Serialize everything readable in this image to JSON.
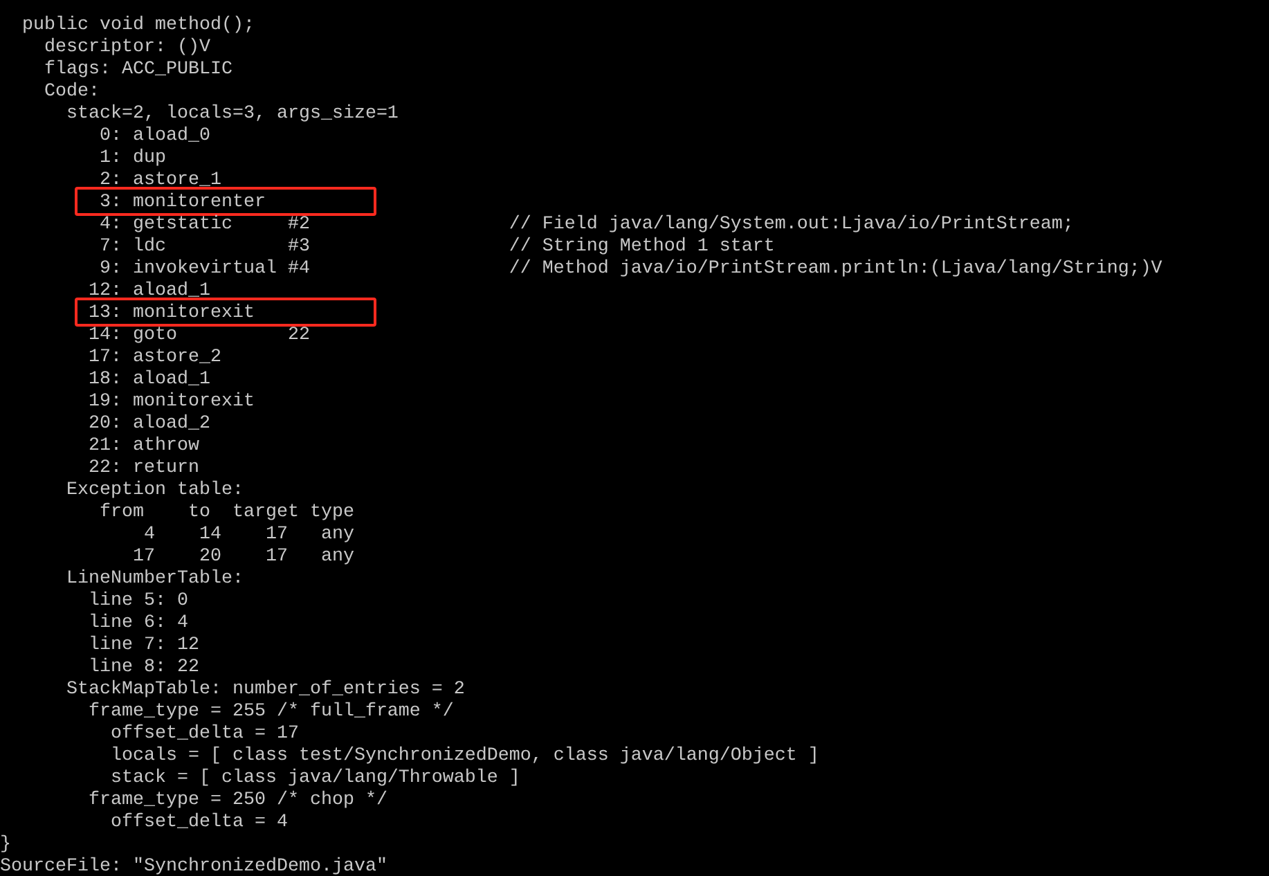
{
  "console": {
    "lines": [
      {
        "text": "  public void method();",
        "highlighted": false
      },
      {
        "text": "    descriptor: ()V",
        "highlighted": false
      },
      {
        "text": "    flags: ACC_PUBLIC",
        "highlighted": false
      },
      {
        "text": "    Code:",
        "highlighted": false
      },
      {
        "text": "      stack=2, locals=3, args_size=1",
        "highlighted": false
      },
      {
        "text": "         0: aload_0",
        "highlighted": false
      },
      {
        "text": "         1: dup",
        "highlighted": false
      },
      {
        "text": "         2: astore_1",
        "highlighted": false
      },
      {
        "text": "         3: monitorenter",
        "highlighted": true
      },
      {
        "text": "         4: getstatic     #2                  // Field java/lang/System.out:Ljava/io/PrintStream;",
        "highlighted": false
      },
      {
        "text": "         7: ldc           #3                  // String Method 1 start",
        "highlighted": false
      },
      {
        "text": "         9: invokevirtual #4                  // Method java/io/PrintStream.println:(Ljava/lang/String;)V",
        "highlighted": false
      },
      {
        "text": "        12: aload_1",
        "highlighted": false
      },
      {
        "text": "        13: monitorexit",
        "highlighted": true
      },
      {
        "text": "        14: goto          22",
        "highlighted": false
      },
      {
        "text": "        17: astore_2",
        "highlighted": false
      },
      {
        "text": "        18: aload_1",
        "highlighted": false
      },
      {
        "text": "        19: monitorexit",
        "highlighted": false
      },
      {
        "text": "        20: aload_2",
        "highlighted": false
      },
      {
        "text": "        21: athrow",
        "highlighted": false
      },
      {
        "text": "        22: return",
        "highlighted": false
      },
      {
        "text": "      Exception table:",
        "highlighted": false
      },
      {
        "text": "         from    to  target type",
        "highlighted": false
      },
      {
        "text": "             4    14    17   any",
        "highlighted": false
      },
      {
        "text": "            17    20    17   any",
        "highlighted": false
      },
      {
        "text": "      LineNumberTable:",
        "highlighted": false
      },
      {
        "text": "        line 5: 0",
        "highlighted": false
      },
      {
        "text": "        line 6: 4",
        "highlighted": false
      },
      {
        "text": "        line 7: 12",
        "highlighted": false
      },
      {
        "text": "        line 8: 22",
        "highlighted": false
      },
      {
        "text": "      StackMapTable: number_of_entries = 2",
        "highlighted": false
      },
      {
        "text": "        frame_type = 255 /* full_frame */",
        "highlighted": false
      },
      {
        "text": "          offset_delta = 17",
        "highlighted": false
      },
      {
        "text": "          locals = [ class test/SynchronizedDemo, class java/lang/Object ]",
        "highlighted": false
      },
      {
        "text": "          stack = [ class java/lang/Throwable ]",
        "highlighted": false
      },
      {
        "text": "        frame_type = 250 /* chop */",
        "highlighted": false
      },
      {
        "text": "          offset_delta = 4",
        "highlighted": false
      },
      {
        "text": "}",
        "highlighted": false
      },
      {
        "text": "SourceFile: \"SynchronizedDemo.java\"",
        "highlighted": false
      }
    ]
  }
}
